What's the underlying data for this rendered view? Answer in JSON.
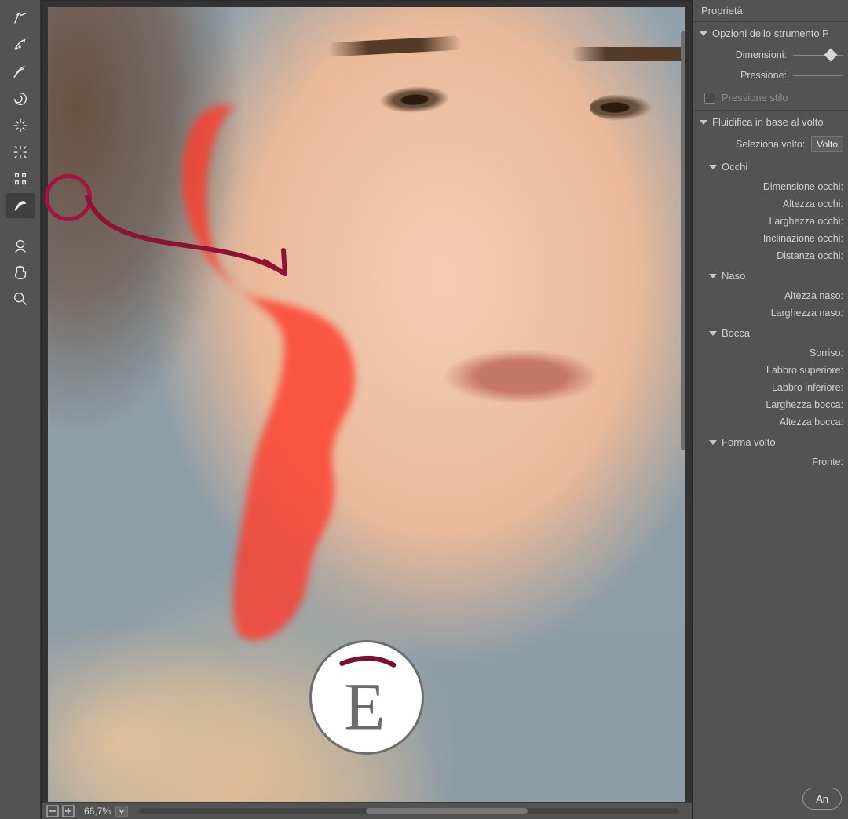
{
  "tools": [
    {
      "name": "forward-warp-tool"
    },
    {
      "name": "reconstruct-tool"
    },
    {
      "name": "smooth-tool"
    },
    {
      "name": "twirl-tool"
    },
    {
      "name": "pucker-tool"
    },
    {
      "name": "bloat-tool"
    },
    {
      "name": "push-left-tool"
    },
    {
      "name": "freeze-mask-tool",
      "selected": true
    },
    {
      "name": "face-tool"
    },
    {
      "name": "hand-tool"
    },
    {
      "name": "zoom-tool"
    }
  ],
  "zoom": {
    "level": "66,7%"
  },
  "panel": {
    "title": "Proprietà",
    "brush": {
      "header": "Opzioni dello strumento P",
      "size_label": "Dimensioni:",
      "pressure_label": "Pressione:",
      "stylus_label": "Pressione stilo"
    },
    "face": {
      "header": "Fluidifica in base al volto",
      "select_label": "Seleziona volto:",
      "select_value": "Volto",
      "eyes": {
        "header": "Occhi",
        "items": [
          "Dimensione occhi:",
          "Altezza occhi:",
          "Larghezza occhi:",
          "Inclinazione occhi:",
          "Distanza occhi:"
        ]
      },
      "nose": {
        "header": "Naso",
        "items": [
          "Altezza naso:",
          "Larghezza naso:"
        ]
      },
      "mouth": {
        "header": "Bocca",
        "items": [
          "Sorriso:",
          "Labbro superiore:",
          "Labbro inferiore:",
          "Larghezza bocca:",
          "Altezza bocca:"
        ]
      },
      "shape": {
        "header": "Forma volto",
        "items": [
          "Fronte:"
        ]
      }
    }
  },
  "buttons": {
    "cancel": "An"
  },
  "logo": {
    "letter": "E"
  }
}
